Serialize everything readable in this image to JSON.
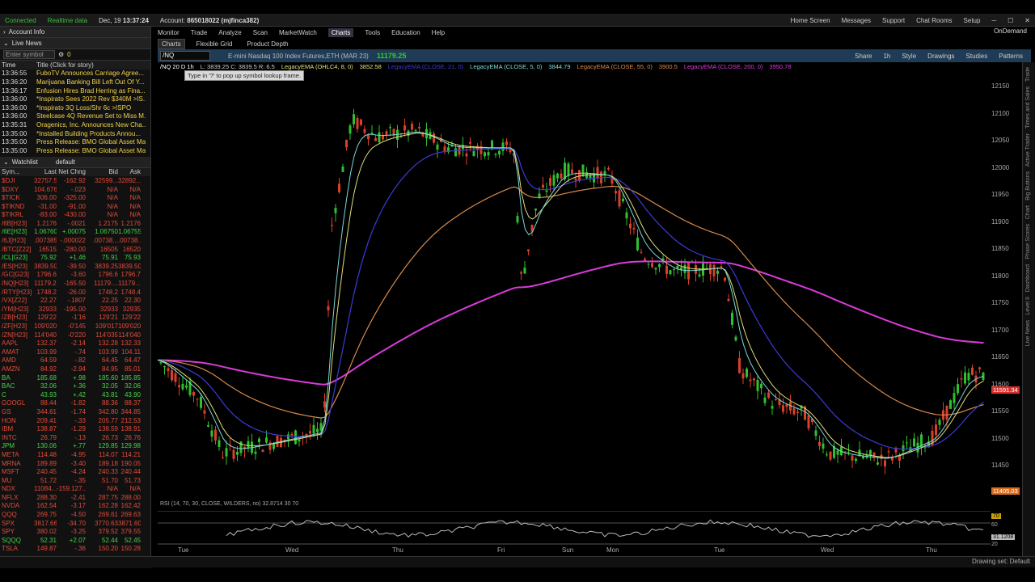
{
  "status": {
    "connected": "Connected",
    "realtime": "Realtime data",
    "date": "Dec, 19",
    "time": "13:37:24",
    "account_label": "Account:",
    "account": "865018022 (mjfinca382)"
  },
  "topright": [
    "Home Screen",
    "Messages",
    "Support",
    "Chat Rooms",
    "Setup"
  ],
  "ondemand": "OnDemand",
  "left": {
    "account_info": "Account Info",
    "live_news": "Live News",
    "enter_symbol": "Enter symbol",
    "news_headers": {
      "time": "Time",
      "title": "Title (Click for story)"
    },
    "news": [
      [
        "13:36:55",
        "FuboTV Announces Carriage Agree..."
      ],
      [
        "13:36:20",
        "Marijuana Banking Bill Left Out Of Y..."
      ],
      [
        "13:36:17",
        "Enfusion Hires Brad Herring as Fina..."
      ],
      [
        "13:36:00",
        "*Inspirato Sees 2022 Rev $340M >IS..."
      ],
      [
        "13:36:00",
        "*Inspirato 3Q Loss/Shr 6c >ISPO"
      ],
      [
        "13:36:00",
        "Steelcase 4Q Revenue Set to Miss M..."
      ],
      [
        "13:35:31",
        "Oragenics, Inc. Announces New Cha..."
      ],
      [
        "13:35:00",
        "*Installed Building Products Annou..."
      ],
      [
        "13:35:00",
        "Press Release: BMO Global Asset Ma..."
      ],
      [
        "13:35:00",
        "Press Release: BMO Global Asset Ma..."
      ]
    ],
    "watchlist": "Watchlist",
    "watchlist_name": "default",
    "wl_headers": {
      "sym": "Sym...",
      "last": "Last",
      "net": "Net Chng",
      "bid": "Bid",
      "ask": "Ask"
    },
    "wl": [
      [
        "$DJI",
        "32757.54",
        "-162.92",
        "32599...",
        "32892...",
        "r"
      ],
      [
        "$DXY",
        "104.676",
        "-.023",
        "N/A",
        "N/A",
        "r"
      ],
      [
        "$TICK",
        "306.00",
        "-325.00",
        "N/A",
        "N/A",
        "r"
      ],
      [
        "$TIKND",
        "-31.00",
        "-91.00",
        "N/A",
        "N/A",
        "r"
      ],
      [
        "$TIKRL",
        "-83.00",
        "-430.00",
        "N/A",
        "N/A",
        "r"
      ],
      [
        "/6B[H23]",
        "1.2176",
        "-.0021",
        "1.2175",
        "1.2176",
        "r"
      ],
      [
        "/6E[H23]",
        "1.06760",
        "+.00075",
        "1.06750",
        "1.06755",
        "g"
      ],
      [
        "/6J[H23]",
        ".0073855",
        "-.000022",
        ".00738...",
        ".00738...",
        "r"
      ],
      [
        "/BTC[Z22]",
        "16515",
        "-280.00",
        "16505",
        "16520",
        "r"
      ],
      [
        "/CL[G23]",
        "75.92",
        "+1.46",
        "75.91",
        "75.93",
        "g"
      ],
      [
        "/ES[H23]",
        "3839.50",
        "-39.50",
        "3839.25",
        "3839.50",
        "r"
      ],
      [
        "/GC[G23]",
        "1796.6",
        "-3.60",
        "1796.6",
        "1796.7",
        "r"
      ],
      [
        "/NQ[H23]",
        "11179.25",
        "-165.50",
        "11179....",
        "11179....",
        "r"
      ],
      [
        "/RTY[H23]",
        "1748.2",
        "-26.00",
        "1748.2",
        "1748.4",
        "r"
      ],
      [
        "/VX[Z22]",
        "22.27",
        "-.1807",
        "22.25",
        "22.30",
        "r"
      ],
      [
        "/YM[H23]",
        "32933",
        "-195.00",
        "32933",
        "32935",
        "r"
      ],
      [
        "/ZB[H23]",
        "129'22",
        "-1'16",
        "129'21",
        "129'22",
        "r"
      ],
      [
        "/ZF[H23]",
        "109'020",
        "-0'145",
        "109'017",
        "109'020",
        "r"
      ],
      [
        "/ZN[H23]",
        "114'040",
        "-0'220",
        "114'035",
        "114'040",
        "r"
      ],
      [
        "AAPL",
        "132.37",
        "-2.14",
        "132.28",
        "132.33",
        "r"
      ],
      [
        "AMAT",
        "103.99",
        "-.74",
        "103.99",
        "104.11",
        "r"
      ],
      [
        "AMD",
        "64.59",
        "-.82",
        "64.45",
        "64.47",
        "r"
      ],
      [
        "AMZN",
        "84.92",
        "-2.94",
        "84.95",
        "85.01",
        "r"
      ],
      [
        "BA",
        "185.68",
        "+.98",
        "185.60",
        "185.85",
        "g"
      ],
      [
        "BAC",
        "32.06",
        "+.36",
        "32.05",
        "32.06",
        "g"
      ],
      [
        "C",
        "43.93",
        "+.42",
        "43.81",
        "43.90",
        "g"
      ],
      [
        "GOOGL",
        "88.44",
        "-1.82",
        "88.36",
        "88.37",
        "r"
      ],
      [
        "GS",
        "344.61",
        "-1.74",
        "342.80",
        "344.85",
        "r"
      ],
      [
        "HON",
        "209.41",
        "-.33",
        "205.77",
        "212.53",
        "r"
      ],
      [
        "IBM",
        "138.87",
        "-1.29",
        "138.59",
        "138.91",
        "r"
      ],
      [
        "INTC",
        "26.79",
        "-.13",
        "26.73",
        "26.76",
        "r"
      ],
      [
        "JPM",
        "130.06",
        "+.77",
        "129.85",
        "129.98",
        "g"
      ],
      [
        "META",
        "114.48",
        "-4.95",
        "114.07",
        "114.21",
        "r"
      ],
      [
        "MRNA",
        "189.89",
        "-3.40",
        "189.18",
        "190.05",
        "r"
      ],
      [
        "MSFT",
        "240.45",
        "-4.24",
        "240.33",
        "240.44",
        "r"
      ],
      [
        "MU",
        "51.72",
        "-.35",
        "51.70",
        "51.73",
        "r"
      ],
      [
        "NDX",
        "11084...",
        "-159.127...",
        "N/A",
        "N/A",
        "r"
      ],
      [
        "NFLX",
        "288.30",
        "-2.41",
        "287.75",
        "288.00",
        "r"
      ],
      [
        "NVDA",
        "162.54",
        "-3.17",
        "162.28",
        "162.42",
        "r"
      ],
      [
        "QQQ",
        "269.75",
        "-4.50",
        "269.61",
        "269.63",
        "r"
      ],
      [
        "SPX",
        "3817.66",
        "-34.70",
        "3770.63",
        "3871.60",
        "r"
      ],
      [
        "SPY",
        "380.02",
        "-3.25",
        "379.52",
        "379.55",
        "r"
      ],
      [
        "SQQQ",
        "52.31",
        "+2.07",
        "52.44",
        "52.45",
        "g"
      ],
      [
        "TSLA",
        "149.87",
        "-.36",
        "150.20",
        "150.28",
        "r"
      ]
    ]
  },
  "nav": [
    "Monitor",
    "Trade",
    "Analyze",
    "Scan",
    "MarketWatch",
    "Charts",
    "Tools",
    "Education",
    "Help"
  ],
  "subtabs": [
    "Charts",
    "Flexible Grid",
    "Product Depth"
  ],
  "symbar": {
    "symbol": "/NQ",
    "title": "E-mini Nasdaq 100 Index Futures,ETH (MAR 23)",
    "price": "11179.25",
    "tools": [
      "Share",
      "1h",
      "Style",
      "Drawings",
      "Studies",
      "Patterns"
    ]
  },
  "legend": [
    {
      "t": "/NQ 20 D 1h",
      "c": "#fff"
    },
    {
      "t": "L: 3839.25 C: 3839.5 R: 6.5",
      "c": "#ccc"
    },
    {
      "t": "LegacyEMA (OHLC4, 8, 0)",
      "c": "#e0e07a"
    },
    {
      "t": "3852.58",
      "c": "#e0e07a"
    },
    {
      "t": "LegacyEMA (CLOSE, 21, 0)",
      "c": "#3b3bd9"
    },
    {
      "t": "LegacyEMA (CLOSE, 5, 0)",
      "c": "#7ad9d9"
    },
    {
      "t": "3844.79",
      "c": "#7ad9d9"
    },
    {
      "t": "LegacyEMA (CLOSE, 55, 0)",
      "c": "#d98a4a"
    },
    {
      "t": "3900.5",
      "c": "#d98a4a"
    },
    {
      "t": "LegacyEMA (CLOSE, 200, 0)",
      "c": "#d93bd9"
    },
    {
      "t": "3950.78",
      "c": "#d93bd9"
    }
  ],
  "tooltip": "Type in '?' to pop up symbol lookup frame.",
  "price_labels": [
    "12150",
    "12100",
    "12050",
    "12000",
    "11950",
    "11900",
    "11850",
    "11800",
    "11750",
    "11700",
    "11650",
    "11600",
    "11550",
    "11500",
    "11450"
  ],
  "price_tags": {
    "current": "11591.34",
    "low": "11405.03"
  },
  "x_labels": [
    "Tue",
    "Wed",
    "Thu",
    "Fri",
    "Sun",
    "Mon",
    "Tue",
    "Wed",
    "Thu"
  ],
  "rsi": "RSI (14, 70, 30, CLOSE, WILDERS, no)  32.8714  30  70",
  "rsi_labels": {
    "a": "70",
    "b": "60",
    "c": "31.1208",
    "d": "20"
  },
  "drawing_set": "Drawing set: Default",
  "rail": [
    "Trade",
    "Times and Sales",
    "Active Trader",
    "Big Buttons",
    "Chart",
    "Phase Scores",
    "Dashboard",
    "Level II",
    "Live News"
  ]
}
